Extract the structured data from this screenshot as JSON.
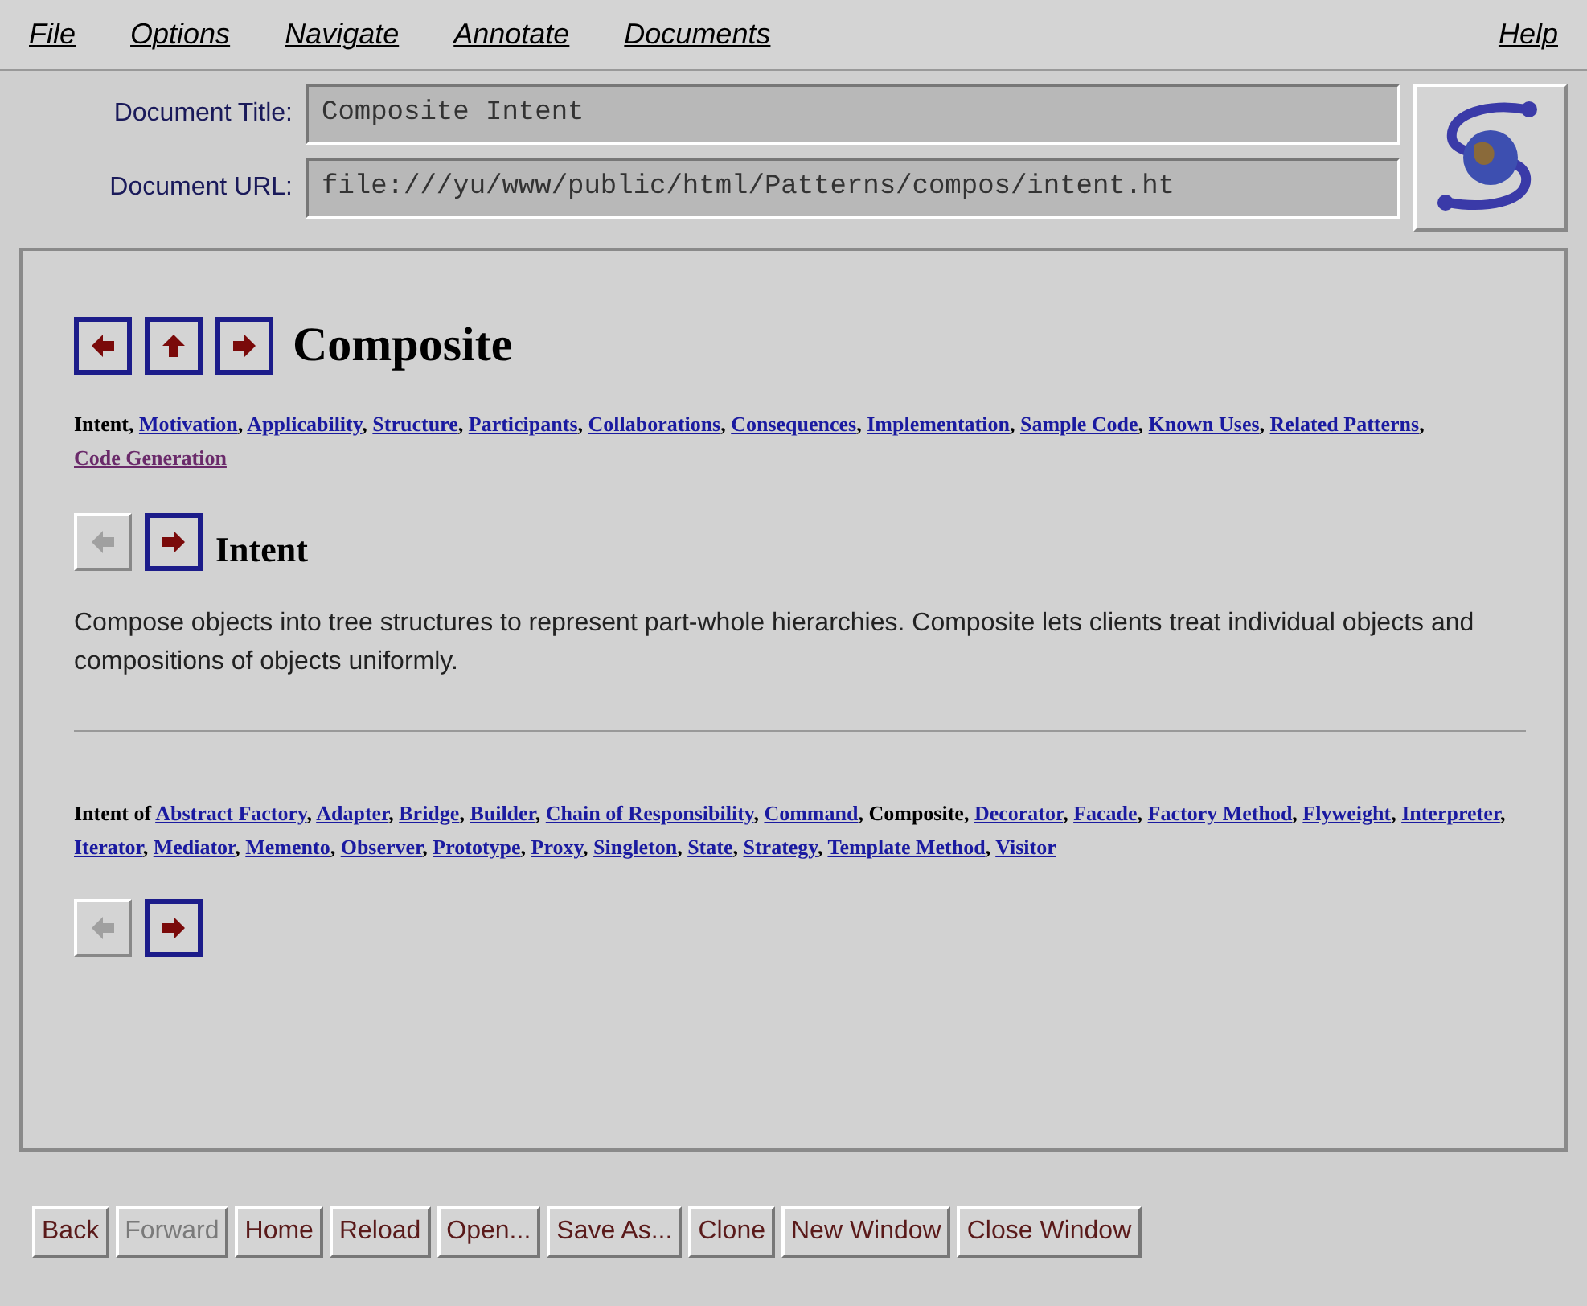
{
  "menu": [
    {
      "label": "File"
    },
    {
      "label": "Options"
    },
    {
      "label": "Navigate"
    },
    {
      "label": "Annotate"
    },
    {
      "label": "Documents"
    },
    {
      "label": "Help"
    }
  ],
  "fields": [
    {
      "label": "Document Title:",
      "value": "Composite Intent"
    },
    {
      "label": "Document URL:",
      "value": "file:///yu/www/public/html/Patterns/compos/intent.ht"
    }
  ],
  "page": {
    "separator": ",",
    "title_nav": [
      {
        "kind": "left-arrow",
        "disabled": false
      },
      {
        "kind": "up-arrow",
        "disabled": false
      },
      {
        "kind": "right-arrow",
        "disabled": false
      }
    ],
    "title": "Composite",
    "sections": [
      {
        "text": "Intent",
        "kind": "current"
      },
      {
        "text": "Motivation",
        "kind": "link"
      },
      {
        "text": "Applicability",
        "kind": "link"
      },
      {
        "text": "Structure",
        "kind": "link"
      },
      {
        "text": "Participants",
        "kind": "link"
      },
      {
        "text": "Collaborations",
        "kind": "link"
      },
      {
        "text": "Consequences",
        "kind": "link"
      },
      {
        "text": "Implementation",
        "kind": "link"
      },
      {
        "text": "Sample Code",
        "kind": "link"
      },
      {
        "text": "Known Uses",
        "kind": "link"
      },
      {
        "text": "Related Patterns",
        "kind": "link"
      },
      {
        "text": "Code Generation",
        "kind": "visited"
      }
    ],
    "heading_nav": [
      {
        "kind": "left-arrow",
        "disabled": true
      },
      {
        "kind": "right-arrow",
        "disabled": false
      }
    ],
    "heading": "Intent",
    "body": "Compose objects into tree structures to represent part-whole hierarchies. Composite lets clients treat individual objects and compositions of objects uniformly.",
    "intent_of_label": "Intent of",
    "patterns": [
      {
        "text": "Abstract Factory",
        "kind": "link"
      },
      {
        "text": "Adapter",
        "kind": "link"
      },
      {
        "text": "Bridge",
        "kind": "link"
      },
      {
        "text": "Builder",
        "kind": "link"
      },
      {
        "text": "Chain of Responsibility",
        "kind": "link"
      },
      {
        "text": "Command",
        "kind": "link"
      },
      {
        "text": "Composite",
        "kind": "current"
      },
      {
        "text": "Decorator",
        "kind": "link"
      },
      {
        "text": "Facade",
        "kind": "link"
      },
      {
        "text": "Factory Method",
        "kind": "link"
      },
      {
        "text": "Flyweight",
        "kind": "link"
      },
      {
        "text": "Interpreter",
        "kind": "link"
      },
      {
        "text": "Iterator",
        "kind": "link"
      },
      {
        "text": "Mediator",
        "kind": "link"
      },
      {
        "text": "Memento",
        "kind": "link"
      },
      {
        "text": "Observer",
        "kind": "link"
      },
      {
        "text": "Prototype",
        "kind": "link"
      },
      {
        "text": "Proxy",
        "kind": "link"
      },
      {
        "text": "Singleton",
        "kind": "link"
      },
      {
        "text": "State",
        "kind": "link"
      },
      {
        "text": "Strategy",
        "kind": "link"
      },
      {
        "text": "Template Method",
        "kind": "link"
      },
      {
        "text": "Visitor",
        "kind": "link"
      }
    ],
    "bottom_nav": [
      {
        "kind": "left-arrow",
        "disabled": true
      },
      {
        "kind": "right-arrow",
        "disabled": false
      }
    ]
  },
  "buttons": [
    {
      "label": "Back",
      "disabled": false
    },
    {
      "label": "Forward",
      "disabled": true
    },
    {
      "label": "Home",
      "disabled": false
    },
    {
      "label": "Reload",
      "disabled": false
    },
    {
      "label": "Open...",
      "disabled": false
    },
    {
      "label": "Save As...",
      "disabled": false
    },
    {
      "label": "Clone",
      "disabled": false
    },
    {
      "label": "New Window",
      "disabled": false
    },
    {
      "label": "Close Window",
      "disabled": false
    }
  ]
}
